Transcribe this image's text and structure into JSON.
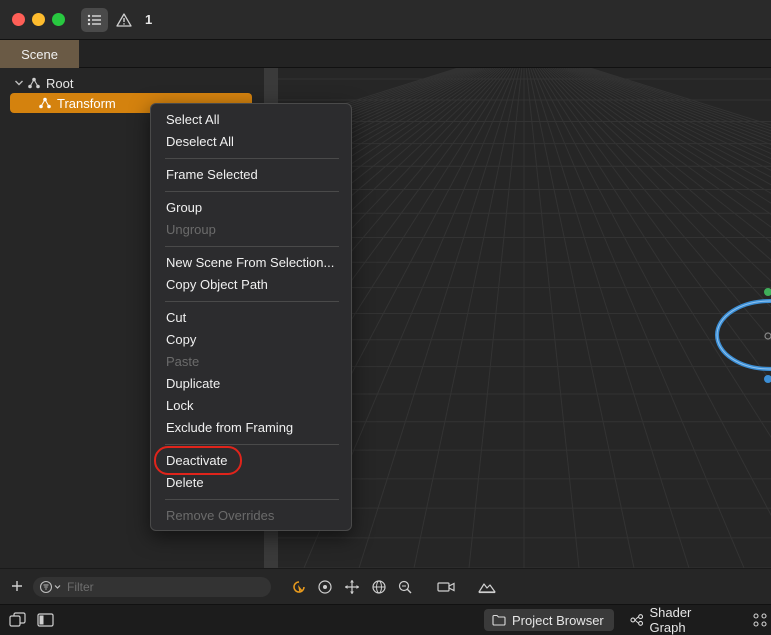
{
  "titlebar": {
    "issue_count": "1",
    "icons": [
      "list-icon",
      "warning-icon"
    ]
  },
  "tabs": {
    "scene_label": "Scene"
  },
  "scene_tree": {
    "root_label": "Root",
    "transform_label": "Transform"
  },
  "context_menu": {
    "items": [
      {
        "label": "Select All",
        "enabled": true
      },
      {
        "label": "Deselect All",
        "enabled": true
      },
      {
        "label": "Frame Selected",
        "enabled": true
      },
      {
        "label": "Group",
        "enabled": true
      },
      {
        "label": "Ungroup",
        "enabled": false
      },
      {
        "label": "New Scene From Selection...",
        "enabled": true
      },
      {
        "label": "Copy Object Path",
        "enabled": true
      },
      {
        "label": "Cut",
        "enabled": true
      },
      {
        "label": "Copy",
        "enabled": true
      },
      {
        "label": "Paste",
        "enabled": false
      },
      {
        "label": "Duplicate",
        "enabled": true
      },
      {
        "label": "Lock",
        "enabled": true
      },
      {
        "label": "Exclude from Framing",
        "enabled": true
      },
      {
        "label": "Deactivate",
        "enabled": true
      },
      {
        "label": "Delete",
        "enabled": true
      },
      {
        "label": "Remove Overrides",
        "enabled": false
      }
    ]
  },
  "filter": {
    "placeholder": "Filter",
    "value": ""
  },
  "statusbar": {
    "project_browser_label": "Project Browser",
    "shader_graph_label": "Shader Graph"
  },
  "colors": {
    "selection": "#d4820e",
    "scene_tab": "#6a5a45",
    "highlight_ring": "#e0241b",
    "gizmo_ring": "#3c8fd6"
  }
}
